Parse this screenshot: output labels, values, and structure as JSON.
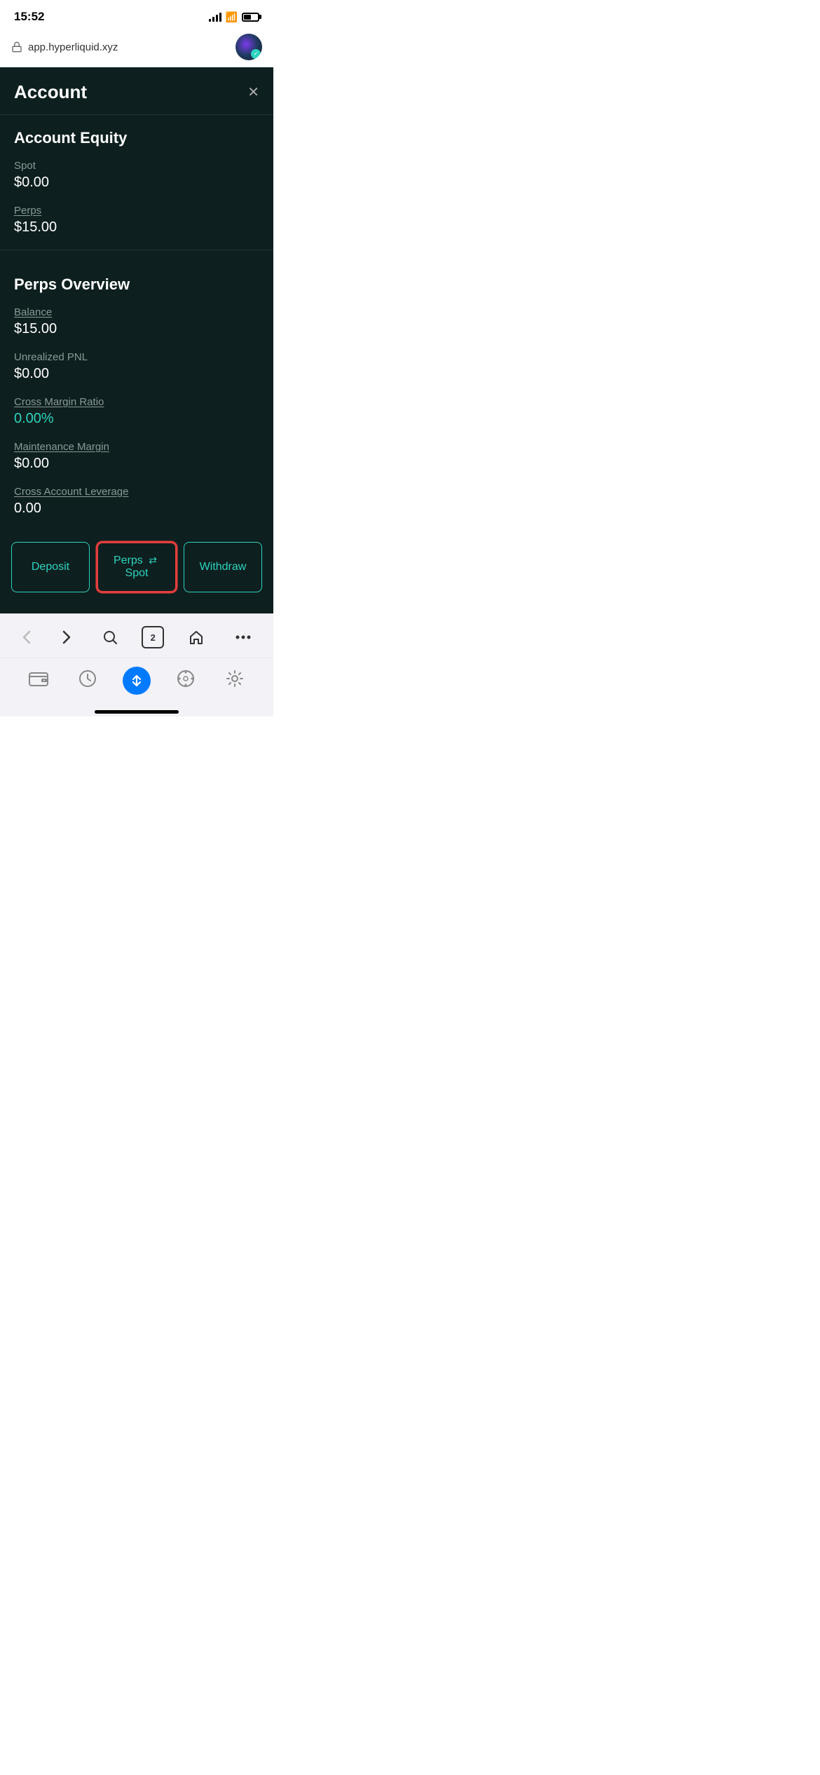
{
  "statusBar": {
    "time": "15:52"
  },
  "browserBar": {
    "url": "app.hyperliquid.xyz"
  },
  "panel": {
    "title": "Account",
    "closeLabel": "✕",
    "accountEquity": {
      "sectionTitle": "Account Equity",
      "spotLabel": "Spot",
      "spotValue": "$0.00",
      "perpsLabel": "Perps",
      "perpsValue": "$15.00"
    },
    "perpsOverview": {
      "sectionTitle": "Perps Overview",
      "balanceLabel": "Balance",
      "balanceValue": "$15.00",
      "unrealizedPNLLabel": "Unrealized PNL",
      "unrealizedPNLValue": "$0.00",
      "crossMarginRatioLabel": "Cross Margin Ratio",
      "crossMarginRatioValue": "0.00%",
      "maintenanceMarginLabel": "Maintenance Margin",
      "maintenanceMarginValue": "$0.00",
      "crossAccountLeverageLabel": "Cross Account Leverage",
      "crossAccountLeverageValue": "0.00"
    }
  },
  "buttons": {
    "deposit": "Deposit",
    "perpsSpot": "Perps",
    "perpsSpotIcon": "⇄",
    "perpsSpotSuffix": "Spot",
    "withdraw": "Withdraw"
  },
  "navBar": {
    "backLabel": "‹",
    "forwardLabel": "›",
    "searchLabel": "🔍",
    "tabsCount": "2",
    "homeLabel": "⌂",
    "moreLabel": "···"
  },
  "dock": {
    "walletIcon": "👛",
    "historyIcon": "🕐",
    "transferIcon": "⇅",
    "compassIcon": "◎",
    "settingsIcon": "⚙"
  }
}
